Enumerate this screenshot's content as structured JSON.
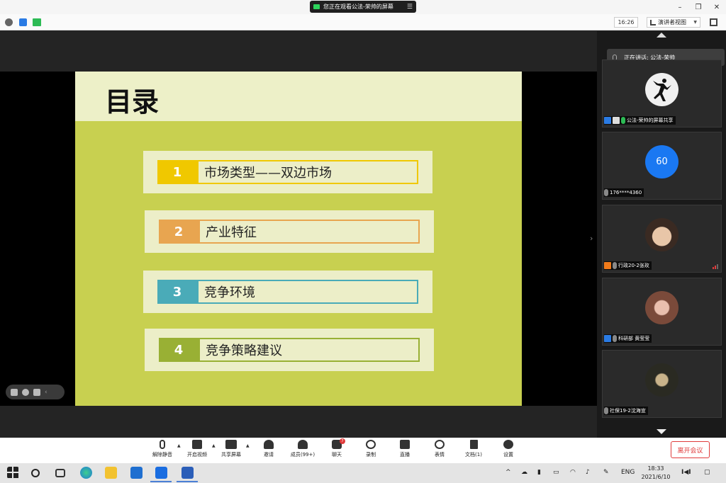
{
  "window": {
    "share_notice": "您正在观看公法-荣帅的屏幕",
    "minimize": "–",
    "restore": "❐",
    "close": "✕"
  },
  "infobar": {
    "time": "16:26",
    "view_label": "演讲者视图"
  },
  "slide": {
    "title": "目录",
    "items": [
      {
        "num": "1",
        "text": "市场类型——双边市场",
        "color": "#f0c800"
      },
      {
        "num": "2",
        "text": "产业特征",
        "color": "#e8a550"
      },
      {
        "num": "3",
        "text": "竞争环境",
        "color": "#4aabb8"
      },
      {
        "num": "4",
        "text": "竞争策略建议",
        "color": "#99b034"
      }
    ]
  },
  "panel": {
    "speaking_label": "正在讲话: 公法-荣帅",
    "participants": [
      {
        "name": "公法-荣帅的屏幕共享",
        "avatar": "jordan-logo"
      },
      {
        "name": "176****4360",
        "avatar_text": "60"
      },
      {
        "name": "行政20-2张玫",
        "avatar": "photo"
      },
      {
        "name": "科研部 黄莹莹",
        "avatar": "photo"
      },
      {
        "name": "社保19-2沈海宣",
        "avatar": "photo"
      }
    ]
  },
  "toolbar": {
    "items": [
      {
        "label": "解除静音",
        "icon": "mic-muted-icon"
      },
      {
        "label": "开启视频",
        "icon": "video-off-icon"
      },
      {
        "label": "共享屏幕",
        "icon": "share-screen-icon"
      },
      {
        "label": "邀请",
        "icon": "invite-icon"
      },
      {
        "label": "成员(99+)",
        "icon": "members-icon"
      },
      {
        "label": "聊天",
        "icon": "chat-icon"
      },
      {
        "label": "录制",
        "icon": "record-icon"
      },
      {
        "label": "直播",
        "icon": "live-icon"
      },
      {
        "label": "表情",
        "icon": "emoji-icon"
      },
      {
        "label": "文档(1)",
        "icon": "document-icon"
      },
      {
        "label": "设置",
        "icon": "settings-icon"
      }
    ],
    "chat_badge": "7",
    "leave_label": "离开会议"
  },
  "taskbar": {
    "lang": "ENG",
    "time": "18:33",
    "date": "2021/6/10"
  }
}
